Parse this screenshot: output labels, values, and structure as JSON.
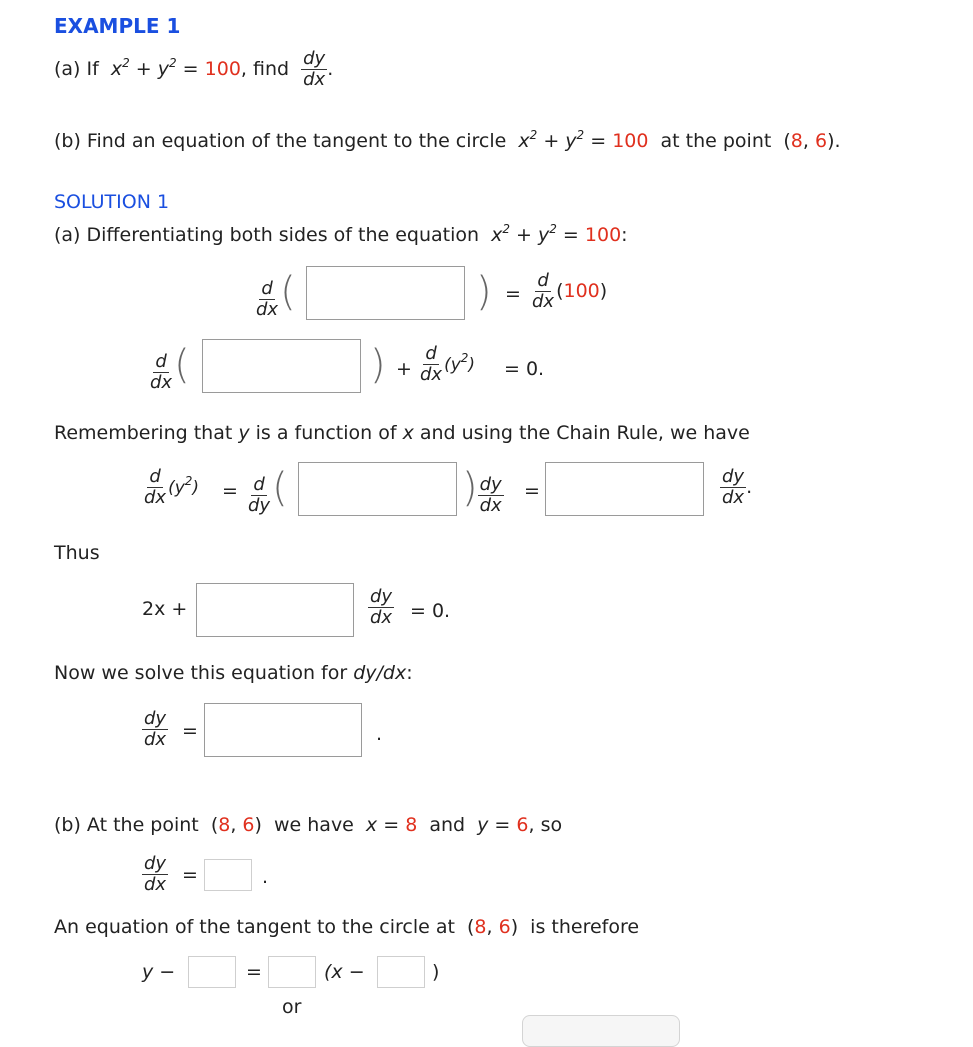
{
  "example": {
    "title": "EXAMPLE 1",
    "part_a": {
      "prefix": "(a) If",
      "eq_left": "x² + y² =",
      "value": "100",
      "mid": ", find",
      "frac_num": "dy",
      "frac_den": "dx",
      "end": "."
    },
    "part_b": {
      "prefix": "(b) Find an equation of the tangent to the circle",
      "eq_left": "x² + y² =",
      "value": "100",
      "mid": "at the point",
      "point_open": "(",
      "px": "8",
      "comma": ", ",
      "py": "6",
      "point_close": ").",
      "x2": "x",
      "y2": "y"
    }
  },
  "solution": {
    "title": "SOLUTION 1",
    "a_intro": {
      "prefix": "(a) Differentiating both sides of the equation",
      "eq_left": "x² + y² =",
      "value": "100",
      "end": ":"
    },
    "eq1": {
      "d": "d",
      "dx": "dx",
      "equals": "=",
      "rhs_open": "(",
      "rhs_value": "100",
      "rhs_close": ")"
    },
    "eq2": {
      "d": "d",
      "dx": "dx",
      "plus": "+",
      "y2": "(y²)",
      "equals": "=  0."
    },
    "chain_rule_text": {
      "p1": "Remembering that ",
      "y": "y",
      "p2": " is a function of ",
      "x": "x",
      "p3": " and using the Chain Rule, we have"
    },
    "eq3": {
      "d": "d",
      "dx": "dx",
      "dy": "dy",
      "y2": "(y²)",
      "equals": "=",
      "equals2": "=",
      "end": "."
    },
    "thus": "Thus",
    "eq4": {
      "left": "2x +",
      "right": "= 0.",
      "dy": "dy",
      "dx": "dx"
    },
    "solve_text": {
      "prefix": "Now we solve this equation for ",
      "expr": "dy/dx",
      "end": ":"
    },
    "eq5": {
      "dy": "dy",
      "dx": "dx",
      "equals": "=",
      "end": "."
    },
    "b_intro": {
      "prefix": "(b) At the point",
      "open": "(",
      "px": "8",
      "comma": ", ",
      "py": "6",
      "close": ")",
      "mid": "we have",
      "xeq": "x =",
      "xval": "8",
      "and": "and",
      "yeq": "y =",
      "yval": "6",
      "end": ", so"
    },
    "eq6": {
      "dy": "dy",
      "dx": "dx",
      "equals": "=",
      "end": "."
    },
    "tangent_text": {
      "prefix": "An equation of the tangent to the circle at",
      "open": "(",
      "px": "8",
      "comma": ", ",
      "py": "6",
      "close": ")",
      "end": "is therefore"
    },
    "eq7": {
      "left": "y −",
      "equals": "=",
      "mid": "(x −",
      "close": ")"
    },
    "or": "or"
  },
  "inputs": {
    "eq1_box": "",
    "eq2_box": "",
    "eq3_box1": "",
    "eq3_box2": "",
    "eq4_box": "",
    "eq5_box": "",
    "eq6_box": "",
    "eq7_box1": "",
    "eq7_box2": "",
    "eq7_box3": ""
  }
}
